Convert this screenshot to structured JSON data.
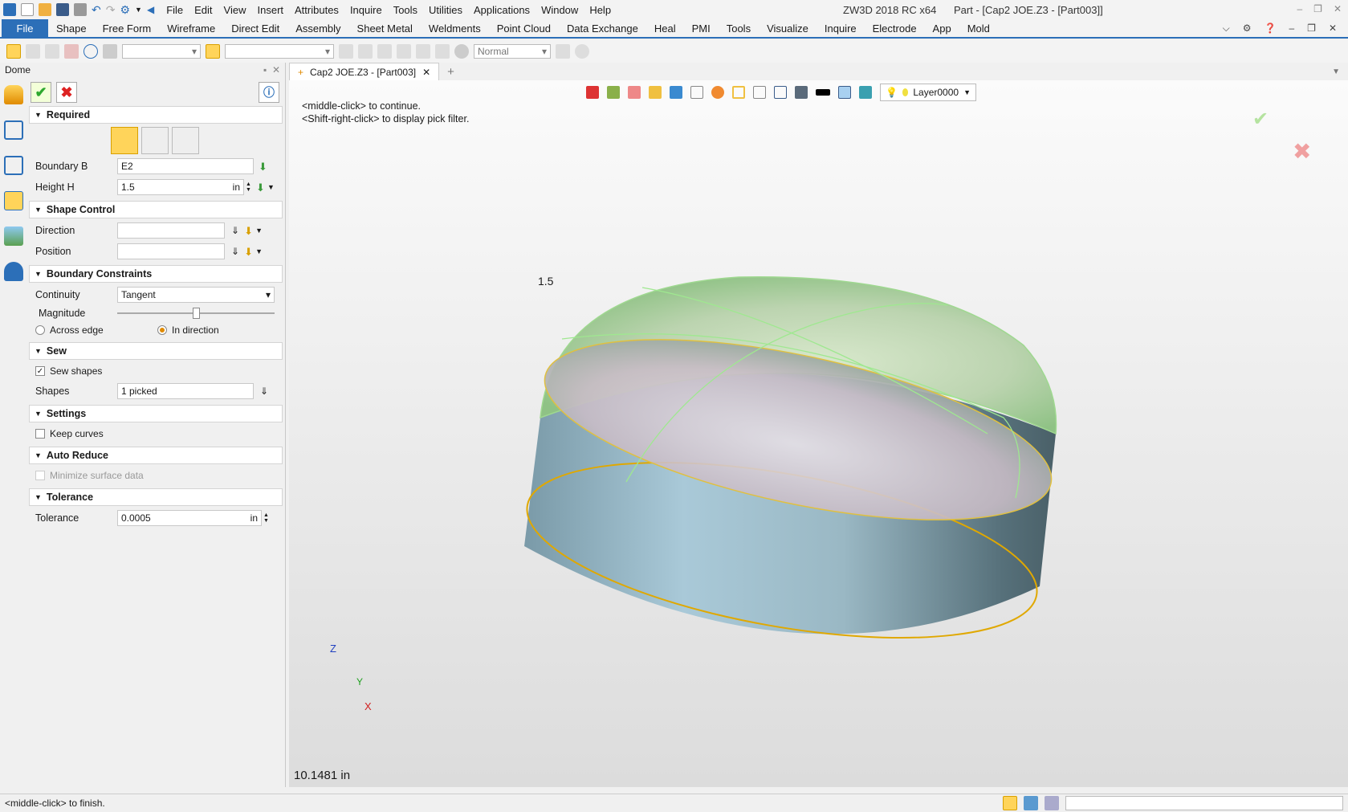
{
  "app": {
    "title": "ZW3D 2018 RC x64",
    "doc_title": "Part - [Cap2 JOE.Z3 - [Part003]]"
  },
  "menu": [
    "File",
    "Edit",
    "View",
    "Insert",
    "Attributes",
    "Inquire",
    "Tools",
    "Utilities",
    "Applications",
    "Window",
    "Help"
  ],
  "ribbon": {
    "file": "File",
    "tabs": [
      "Shape",
      "Free Form",
      "Wireframe",
      "Direct Edit",
      "Assembly",
      "Sheet Metal",
      "Weldments",
      "Point Cloud",
      "Data Exchange",
      "Heal",
      "PMI",
      "Tools",
      "Visualize",
      "Inquire",
      "Electrode",
      "App",
      "Mold"
    ]
  },
  "toolbar": {
    "render_mode": "Normal"
  },
  "panel": {
    "title": "Dome",
    "sections": {
      "required": "Required",
      "shape_control": "Shape Control",
      "boundary_constraints": "Boundary Constraints",
      "sew": "Sew",
      "settings": "Settings",
      "auto_reduce": "Auto Reduce",
      "tolerance": "Tolerance"
    },
    "boundary": {
      "label": "Boundary B",
      "value": "E2"
    },
    "height": {
      "label": "Height H",
      "value": "1.5",
      "unit": "in"
    },
    "direction": {
      "label": "Direction",
      "value": ""
    },
    "position": {
      "label": "Position",
      "value": ""
    },
    "continuity": {
      "label": "Continuity",
      "value": "Tangent"
    },
    "magnitude": {
      "label": "Magnitude",
      "level": 0.5
    },
    "across_edge": "Across edge",
    "in_direction": "In direction",
    "sew_shapes": "Sew shapes",
    "shapes": {
      "label": "Shapes",
      "value": "1 picked"
    },
    "keep_curves": "Keep curves",
    "minimize": "Minimize surface data",
    "tol": {
      "label": "Tolerance",
      "value": "0.0005",
      "unit": "in"
    }
  },
  "viewport": {
    "tab": "Cap2 JOE.Z3 - [Part003]",
    "layer": "Layer0000",
    "prompt1": "<middle-click> to continue.",
    "prompt2": "<Shift-right-click> to display pick filter.",
    "dim_label": "1.5",
    "distance": "10.1481 in",
    "axis_z": "Z",
    "axis_y": "Y",
    "axis_x": "X"
  },
  "status": {
    "text": "<middle-click> to finish."
  }
}
